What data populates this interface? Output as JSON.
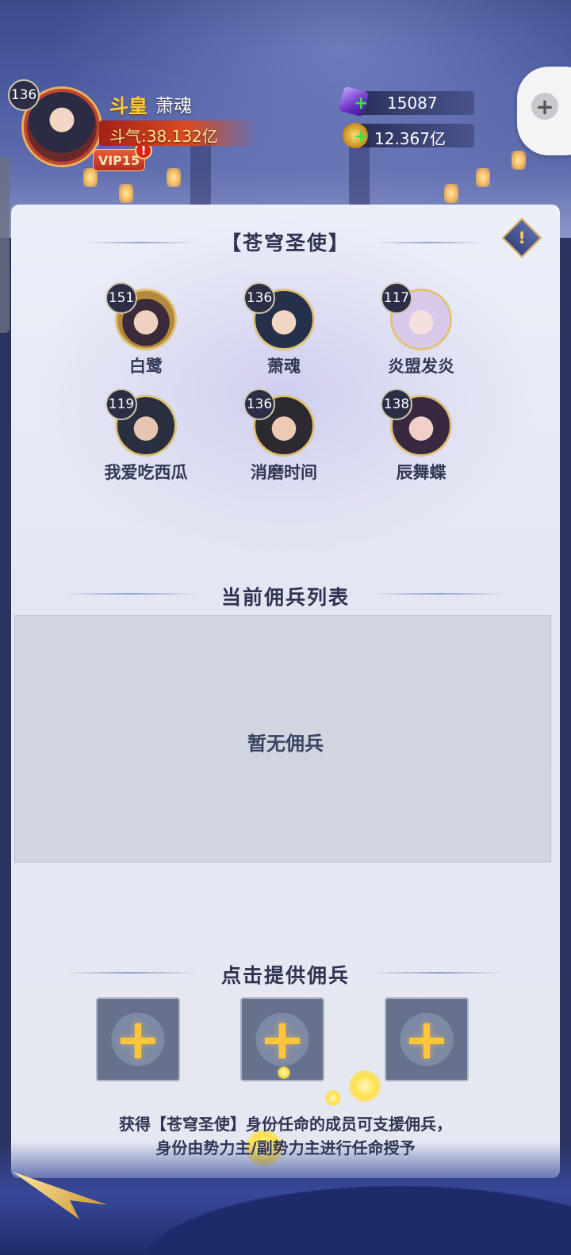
{
  "player": {
    "level": "136",
    "rank": "斗皇",
    "name": "萧魂",
    "power": "斗气:38.132亿",
    "vip": "VIP15",
    "alert": "!"
  },
  "resources": {
    "gems": "15087",
    "gold": "12.367亿"
  },
  "panel": {
    "title": "【苍穹圣使】",
    "info_glyph": "!",
    "members": [
      {
        "level": "151",
        "name": "白鹭"
      },
      {
        "level": "136",
        "name": "萧魂"
      },
      {
        "level": "117",
        "name": "炎盟发炎"
      },
      {
        "level": "119",
        "name": "我爱吃西瓜"
      },
      {
        "level": "136",
        "name": "消磨时间"
      },
      {
        "level": "138",
        "name": "辰舞蝶"
      }
    ],
    "mercenary_title": "当前佣兵列表",
    "empty_text": "暂无佣兵",
    "provide_title": "点击提供佣兵",
    "slot_glyph": "+",
    "note_line1": "获得【苍穹圣使】身份任命的成员可支援佣兵，",
    "note_line2": "身份由势力主/副势力主进行任命授予"
  },
  "icons": {
    "gem": "purple-gem-icon",
    "gold": "gold-coin-icon",
    "add": "plus-icon",
    "gamepad": "gamepad-icon",
    "info": "exclamation-diamond-icon"
  },
  "colors": {
    "rank": "#ffcf3a",
    "power_bar": "#d94a20",
    "slot_plus": "#ffc63a",
    "add_green": "#3ee04a"
  }
}
